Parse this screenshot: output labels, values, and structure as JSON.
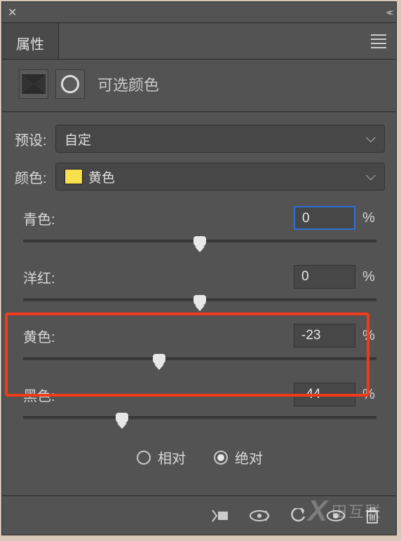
{
  "panel": {
    "tab_label": "属性",
    "title": "可选颜色"
  },
  "preset": {
    "label": "预设:",
    "value": "自定"
  },
  "color": {
    "label": "颜色:",
    "value": "黄色",
    "swatch": "#f9e04d"
  },
  "sliders": {
    "cyan": {
      "label": "青色:",
      "value": "0",
      "unit": "%",
      "pos": 50,
      "focused": true
    },
    "magenta": {
      "label": "洋红:",
      "value": "0",
      "unit": "%",
      "pos": 50
    },
    "yellow": {
      "label": "黄色:",
      "value": "-23",
      "unit": "%",
      "pos": 38.5
    },
    "black": {
      "label": "黑色:",
      "value": "-44",
      "unit": "%",
      "pos": 28
    }
  },
  "method": {
    "relative": "相对",
    "absolute": "绝对",
    "selected": "absolute"
  },
  "watermark": "田互联"
}
